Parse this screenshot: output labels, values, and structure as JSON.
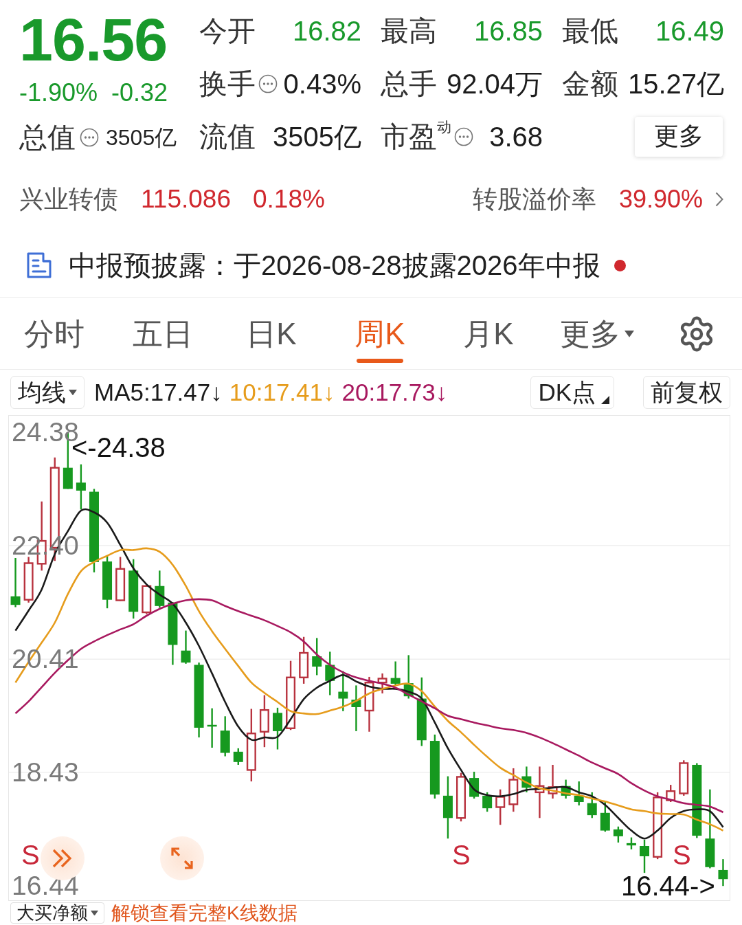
{
  "quote": {
    "price": "16.56",
    "change_pct": "-1.90%",
    "change": "-0.32",
    "falling": true
  },
  "total_value": {
    "label": "总值",
    "value": "3505亿",
    "info": true
  },
  "stats": [
    {
      "label": "今开",
      "value": "16.82",
      "color": "#19992b",
      "info": false
    },
    {
      "label": "最高",
      "value": "16.85",
      "color": "#19992b",
      "info": false
    },
    {
      "label": "最低",
      "value": "16.49",
      "color": "#19992b",
      "info": false
    },
    {
      "label": "换手",
      "value": "0.43%",
      "color": "#1c1c1c",
      "info": true
    },
    {
      "label": "总手",
      "value": "92.04万",
      "color": "#1c1c1c",
      "info": false
    },
    {
      "label": "金额",
      "value": "15.27亿",
      "color": "#1c1c1c",
      "info": false
    },
    {
      "label": "流值",
      "value": "3505亿",
      "color": "#1c1c1c",
      "info": false
    },
    {
      "label": "市盈$^{动}$",
      "value": "3.68",
      "color": "#1c1c1c",
      "info": true
    }
  ],
  "more_button": "更多",
  "bond": {
    "name": "兴业转债",
    "price": "115.086",
    "change_pct": "0.18%",
    "rising": true,
    "premium_label": "转股溢价率",
    "premium_value": "39.90%"
  },
  "notice": {
    "text": "中报预披露：于2026-08-28披露2026年中报",
    "unread": true
  },
  "tabs": [
    {
      "label": "分时",
      "kind": "period",
      "selected": false
    },
    {
      "label": "五日",
      "kind": "period",
      "selected": false
    },
    {
      "label": "日K",
      "kind": "period",
      "selected": false
    },
    {
      "label": "周K",
      "kind": "period",
      "selected": true
    },
    {
      "label": "月K",
      "kind": "period",
      "selected": false
    },
    {
      "label": "更多",
      "kind": "menu",
      "selected": false
    }
  ],
  "indicator_bar": {
    "selector": "均线",
    "averages": [
      {
        "text": "MA5:17.47↓",
        "color": "#1a1a1a"
      },
      {
        "text": "10:17.41↓",
        "color": "#e69c1c"
      },
      {
        "text": "20:17.73↓",
        "color": "#a8195f"
      }
    ],
    "dk_button": "DK点",
    "adjust_button": "前复权"
  },
  "chart": {
    "chart_data": {
      "type": "candlestick",
      "grid": true,
      "ylim": [
        16.19,
        24.67
      ],
      "yticks": [
        {
          "value": 24.38,
          "label": "24.38"
        },
        {
          "value": 22.4,
          "label": "22.40"
        },
        {
          "value": 20.41,
          "label": "20.41"
        },
        {
          "value": 18.43,
          "label": "18.43"
        },
        {
          "value": 16.44,
          "label": "16.44"
        }
      ],
      "categories": [
        null,
        null,
        null,
        null,
        null,
        null,
        null,
        null,
        null,
        null,
        null,
        null,
        null,
        null,
        null,
        null,
        null,
        null,
        null,
        null,
        null,
        null,
        null,
        null,
        null,
        null,
        null,
        null,
        null,
        null,
        null,
        null,
        null,
        null,
        null,
        null,
        null,
        null,
        null,
        null,
        null,
        null,
        null,
        null,
        null,
        null,
        null,
        null,
        null,
        null,
        null,
        null,
        null,
        null,
        null
      ],
      "ohlc": [
        [
          21.51,
          22.18,
          21.32,
          21.36
        ],
        [
          21.45,
          22.2,
          21.4,
          22.09
        ],
        [
          22.08,
          23.17,
          21.96,
          22.48
        ],
        [
          22.36,
          23.94,
          22.13,
          23.76
        ],
        [
          23.76,
          24.38,
          23.39,
          23.39
        ],
        [
          23.5,
          23.82,
          23.03,
          23.36
        ],
        [
          23.34,
          23.39,
          21.93,
          22.11
        ],
        [
          22.12,
          22.22,
          21.3,
          21.45
        ],
        [
          21.44,
          22.2,
          21.43,
          21.99
        ],
        [
          21.96,
          22.16,
          21.12,
          21.24
        ],
        [
          21.23,
          21.71,
          21.2,
          21.69
        ],
        [
          21.69,
          21.96,
          21.31,
          21.34
        ],
        [
          21.4,
          21.41,
          20.31,
          20.66
        ],
        [
          20.56,
          20.91,
          20.33,
          20.35
        ],
        [
          20.31,
          20.35,
          19.04,
          19.21
        ],
        [
          19.26,
          19.55,
          18.86,
          19.23
        ],
        [
          19.16,
          19.41,
          18.71,
          18.77
        ],
        [
          18.79,
          18.85,
          18.56,
          18.61
        ],
        [
          18.47,
          19.54,
          18.27,
          19.11
        ],
        [
          19.14,
          19.78,
          18.87,
          19.52
        ],
        [
          19.47,
          19.56,
          18.83,
          19.15
        ],
        [
          19.2,
          20.38,
          19.17,
          20.09
        ],
        [
          20.09,
          20.8,
          19.98,
          20.52
        ],
        [
          20.46,
          20.78,
          20.13,
          20.28
        ],
        [
          20.31,
          20.54,
          19.78,
          20.03
        ],
        [
          19.84,
          20.2,
          19.5,
          19.72
        ],
        [
          19.7,
          19.95,
          19.15,
          19.57
        ],
        [
          19.51,
          20.1,
          19.14,
          20.0
        ],
        [
          20.0,
          20.16,
          19.81,
          20.07
        ],
        [
          20.08,
          20.37,
          19.95,
          19.98
        ],
        [
          19.99,
          20.48,
          19.72,
          19.76
        ],
        [
          19.72,
          20.09,
          18.89,
          18.99
        ],
        [
          18.98,
          19.09,
          17.97,
          18.04
        ],
        [
          18.02,
          18.36,
          17.27,
          17.63
        ],
        [
          17.63,
          18.42,
          17.57,
          18.35
        ],
        [
          18.33,
          18.44,
          17.97,
          18.0
        ],
        [
          18.02,
          18.08,
          17.74,
          17.8
        ],
        [
          17.82,
          18.13,
          17.51,
          18.0
        ],
        [
          17.87,
          18.5,
          17.74,
          18.3
        ],
        [
          18.36,
          18.53,
          18.08,
          18.16
        ],
        [
          18.08,
          18.53,
          17.63,
          18.19
        ],
        [
          18.06,
          18.56,
          17.97,
          18.17
        ],
        [
          18.19,
          18.3,
          17.97,
          18.02
        ],
        [
          18.02,
          18.27,
          17.85,
          17.91
        ],
        [
          17.89,
          18.08,
          17.63,
          17.68
        ],
        [
          17.72,
          17.91,
          17.39,
          17.41
        ],
        [
          17.43,
          17.48,
          17.2,
          17.31
        ],
        [
          17.19,
          17.29,
          17.08,
          17.15
        ],
        [
          17.14,
          17.25,
          16.67,
          16.96
        ],
        [
          16.95,
          18.08,
          16.91,
          17.99
        ],
        [
          17.94,
          18.21,
          17.91,
          18.1
        ],
        [
          18.06,
          18.64,
          18.02,
          18.59
        ],
        [
          18.56,
          18.59,
          17.28,
          17.32
        ],
        [
          17.27,
          18.13,
          16.75,
          16.77
        ],
        [
          16.72,
          16.91,
          16.44,
          16.56
        ]
      ],
      "series": [
        {
          "type": "line",
          "color": "#1a1a1a",
          "values": [
            20.91,
            21.26,
            21.63,
            22.25,
            22.65,
            23.01,
            22.98,
            22.8,
            22.41,
            22.0,
            21.72,
            21.54,
            21.38,
            21.05,
            20.64,
            20.16,
            19.66,
            19.23,
            19.0,
            19.04,
            19.05,
            19.36,
            19.71,
            19.91,
            20.03,
            20.13,
            20.02,
            19.93,
            19.89,
            19.89,
            19.84,
            19.72,
            19.3,
            18.85,
            18.47,
            18.13,
            18.03,
            18.01,
            18.05,
            18.12,
            18.14,
            18.16,
            18.17,
            18.08,
            18.01,
            17.86,
            17.63,
            17.41,
            17.27,
            17.41,
            17.63,
            17.75,
            17.78,
            17.75,
            17.47
          ]
        },
        {
          "type": "line",
          "color": "#e69c1c",
          "values": [
            20.0,
            20.36,
            20.7,
            21.05,
            21.55,
            21.95,
            22.11,
            22.22,
            22.32,
            22.32,
            22.35,
            22.29,
            22.06,
            21.69,
            21.25,
            20.9,
            20.59,
            20.29,
            20.0,
            19.82,
            19.66,
            19.5,
            19.46,
            19.45,
            19.51,
            19.58,
            19.68,
            19.81,
            19.89,
            19.95,
            19.98,
            19.85,
            19.58,
            19.33,
            19.13,
            18.91,
            18.7,
            18.51,
            18.38,
            18.25,
            18.15,
            18.11,
            18.06,
            18.03,
            17.97,
            17.92,
            17.85,
            17.78,
            17.75,
            17.71,
            17.7,
            17.69,
            17.6,
            17.52,
            17.41
          ]
        },
        {
          "type": "line",
          "color": "#a8195f",
          "values": [
            19.46,
            19.67,
            19.92,
            20.17,
            20.39,
            20.59,
            20.72,
            20.83,
            20.93,
            21.02,
            21.17,
            21.29,
            21.38,
            21.44,
            21.46,
            21.44,
            21.34,
            21.25,
            21.17,
            21.09,
            20.99,
            20.88,
            20.72,
            20.49,
            20.31,
            20.18,
            20.09,
            20.03,
            19.98,
            19.91,
            19.79,
            19.67,
            19.55,
            19.42,
            19.36,
            19.3,
            19.25,
            19.2,
            19.17,
            19.12,
            19.04,
            18.94,
            18.83,
            18.72,
            18.6,
            18.5,
            18.4,
            18.24,
            18.11,
            18.01,
            17.95,
            17.89,
            17.86,
            17.83,
            17.73
          ]
        }
      ]
    },
    "high_marker": "<-24.38",
    "low_marker": "16.44->",
    "signals": [
      "S",
      "S",
      "S"
    ]
  },
  "bottom_bar": {
    "selector": "大买净额",
    "unlock_link": "解锁查看完整K线数据"
  }
}
